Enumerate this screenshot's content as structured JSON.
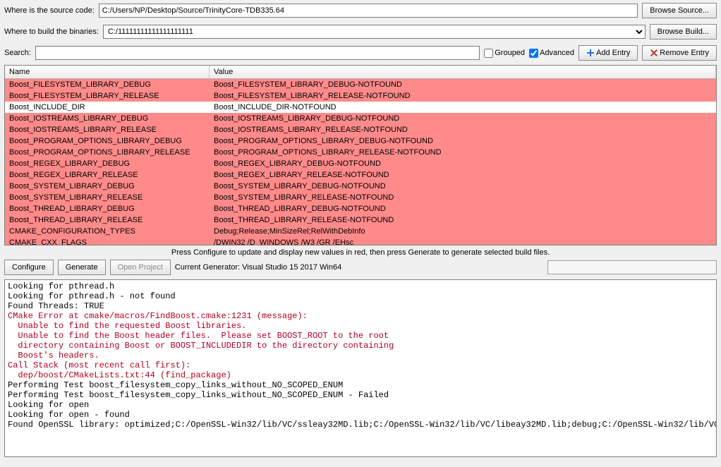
{
  "labels": {
    "source": "Where is the source code:",
    "build": "Where to build the binaries:",
    "search": "Search:",
    "browse_source": "Browse Source...",
    "browse_build": "Browse Build...",
    "grouped": "Grouped",
    "advanced": "Advanced",
    "add_entry": "Add Entry",
    "remove_entry": "Remove Entry",
    "col_name": "Name",
    "col_value": "Value",
    "hint": "Press Configure to update and display new values in red, then press Generate to generate selected build files.",
    "configure": "Configure",
    "generate": "Generate",
    "open_project": "Open Project",
    "current_generator": "Current Generator: Visual Studio 15 2017 Win64"
  },
  "paths": {
    "source": "C:/Users/NP/Desktop/Source/TrinityCore-TDB335.64",
    "build": "C:/11111111111111111111"
  },
  "checkboxes": {
    "grouped": false,
    "advanced": true
  },
  "rows": [
    {
      "name": "Boost_FILESYSTEM_LIBRARY_DEBUG",
      "value": "Boost_FILESYSTEM_LIBRARY_DEBUG-NOTFOUND",
      "red": true
    },
    {
      "name": "Boost_FILESYSTEM_LIBRARY_RELEASE",
      "value": "Boost_FILESYSTEM_LIBRARY_RELEASE-NOTFOUND",
      "red": true
    },
    {
      "name": "Boost_INCLUDE_DIR",
      "value": "Boost_INCLUDE_DIR-NOTFOUND",
      "red": false
    },
    {
      "name": "Boost_IOSTREAMS_LIBRARY_DEBUG",
      "value": "Boost_IOSTREAMS_LIBRARY_DEBUG-NOTFOUND",
      "red": true
    },
    {
      "name": "Boost_IOSTREAMS_LIBRARY_RELEASE",
      "value": "Boost_IOSTREAMS_LIBRARY_RELEASE-NOTFOUND",
      "red": true
    },
    {
      "name": "Boost_PROGRAM_OPTIONS_LIBRARY_DEBUG",
      "value": "Boost_PROGRAM_OPTIONS_LIBRARY_DEBUG-NOTFOUND",
      "red": true
    },
    {
      "name": "Boost_PROGRAM_OPTIONS_LIBRARY_RELEASE",
      "value": "Boost_PROGRAM_OPTIONS_LIBRARY_RELEASE-NOTFOUND",
      "red": true
    },
    {
      "name": "Boost_REGEX_LIBRARY_DEBUG",
      "value": "Boost_REGEX_LIBRARY_DEBUG-NOTFOUND",
      "red": true
    },
    {
      "name": "Boost_REGEX_LIBRARY_RELEASE",
      "value": "Boost_REGEX_LIBRARY_RELEASE-NOTFOUND",
      "red": true
    },
    {
      "name": "Boost_SYSTEM_LIBRARY_DEBUG",
      "value": "Boost_SYSTEM_LIBRARY_DEBUG-NOTFOUND",
      "red": true
    },
    {
      "name": "Boost_SYSTEM_LIBRARY_RELEASE",
      "value": "Boost_SYSTEM_LIBRARY_RELEASE-NOTFOUND",
      "red": true
    },
    {
      "name": "Boost_THREAD_LIBRARY_DEBUG",
      "value": "Boost_THREAD_LIBRARY_DEBUG-NOTFOUND",
      "red": true
    },
    {
      "name": "Boost_THREAD_LIBRARY_RELEASE",
      "value": "Boost_THREAD_LIBRARY_RELEASE-NOTFOUND",
      "red": true
    },
    {
      "name": "CMAKE_CONFIGURATION_TYPES",
      "value": "Debug;Release;MinSizeRel;RelWithDebInfo",
      "red": true
    },
    {
      "name": "CMAKE_CXX_FLAGS",
      "value": "/DWIN32 /D_WINDOWS /W3 /GR /EHsc",
      "red": true
    }
  ],
  "console": [
    {
      "t": "Looking for pthread.h"
    },
    {
      "t": "Looking for pthread.h - not found"
    },
    {
      "t": "Found Threads: TRUE"
    },
    {
      "t": "CMake Error at cmake/macros/FindBoost.cmake:1231 (message):",
      "e": true
    },
    {
      "t": "  Unable to find the requested Boost libraries.",
      "e": true
    },
    {
      "t": ""
    },
    {
      "t": "  Unable to find the Boost header files.  Please set BOOST_ROOT to the root",
      "e": true
    },
    {
      "t": "  directory containing Boost or BOOST_INCLUDEDIR to the directory containing",
      "e": true
    },
    {
      "t": "  Boost's headers.",
      "e": true
    },
    {
      "t": "Call Stack (most recent call first):",
      "e": true
    },
    {
      "t": "  dep/boost/CMakeLists.txt:44 (find_package)",
      "e": true
    },
    {
      "t": ""
    },
    {
      "t": ""
    },
    {
      "t": "Performing Test boost_filesystem_copy_links_without_NO_SCOPED_ENUM"
    },
    {
      "t": "Performing Test boost_filesystem_copy_links_without_NO_SCOPED_ENUM - Failed"
    },
    {
      "t": "Looking for open"
    },
    {
      "t": "Looking for open - found"
    },
    {
      "t": "Found OpenSSL library: optimized;C:/OpenSSL-Win32/lib/VC/ssleay32MD.lib;C:/OpenSSL-Win32/lib/VC/libeay32MD.lib;debug;C:/OpenSSL-Win32/lib/VC/"
    }
  ]
}
